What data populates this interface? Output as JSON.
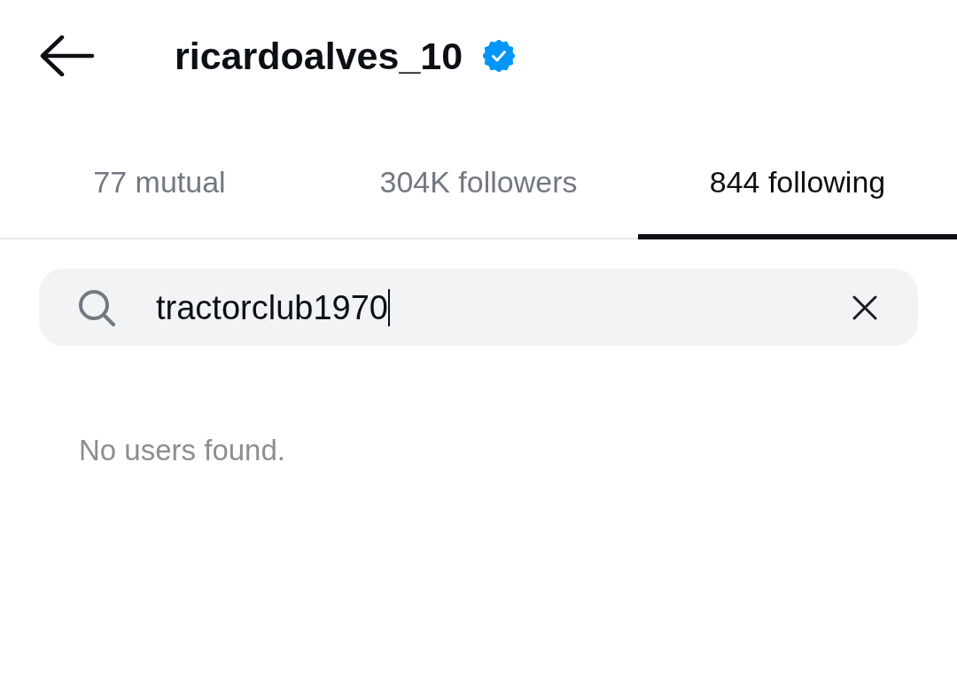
{
  "header": {
    "title": "ricardoalves_10",
    "verified": true
  },
  "tabs": [
    {
      "label": "77 mutual",
      "selected": false
    },
    {
      "label": "304K followers",
      "selected": false
    },
    {
      "label": "844 following",
      "selected": true
    }
  ],
  "search": {
    "value": "tractorclub1970",
    "focused": true
  },
  "empty_message": "No users found."
}
